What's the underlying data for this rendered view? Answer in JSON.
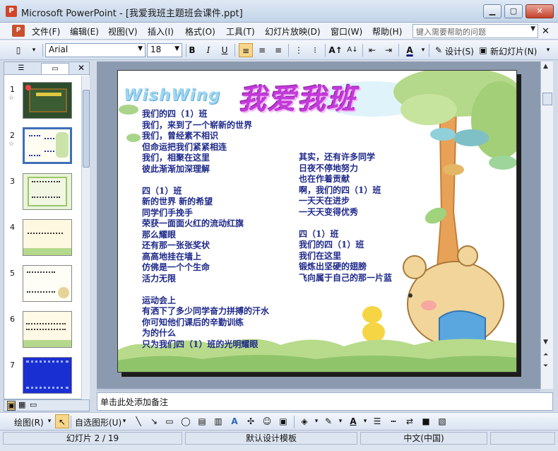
{
  "window": {
    "app_title": "Microsoft PowerPoint - [我爱我班主题班会课件.ppt]",
    "app_icon": "P"
  },
  "menu": {
    "items": [
      "文件(F)",
      "编辑(E)",
      "视图(V)",
      "插入(I)",
      "格式(O)",
      "工具(T)",
      "幻灯片放映(D)",
      "窗口(W)",
      "帮助(H)"
    ],
    "help_placeholder": "键入需要帮助的问题"
  },
  "toolbar": {
    "font": "Arial",
    "size": "18",
    "bold": "B",
    "italic": "I",
    "underline": "U",
    "design_label": "设计(S)",
    "new_slide_label": "新幻灯片(N)"
  },
  "slide_pane": {
    "thumbs": [
      {
        "num": "1"
      },
      {
        "num": "2"
      },
      {
        "num": "3"
      },
      {
        "num": "4"
      },
      {
        "num": "5"
      },
      {
        "num": "6"
      },
      {
        "num": "7"
      }
    ]
  },
  "slide": {
    "title": "我爱我班",
    "logo": "WishWing",
    "col1": [
      "我们的四（1）班",
      "我们，来到了一个崭新的世界",
      "我们，曾经素不相识",
      "但命运把我们紧紧相连",
      "我们，相聚在这里",
      "彼此渐渐加深理解",
      "",
      "四（1）班",
      "新的世界 新的希望",
      "同学们手挽手",
      "荣获一面面火红的流动红旗",
      "那么耀眼",
      "还有那一张张奖状",
      "高高地挂在墙上",
      "仿佛是一个个生命",
      "活力无限",
      "",
      "运动会上",
      "有洒下了多少同学奋力拼搏的汗水",
      "你可知他们课后的辛勤训练",
      "为的什么",
      "只为我们四（1）班的光明耀眼"
    ],
    "col2": [
      "其实，还有许多同学",
      "日夜不停地努力",
      "也在作着贡献",
      "啊，我们的四（1）班",
      "一天天在进步",
      "一天天变得优秀",
      "",
      "四（1）班",
      "我们的四（1）班",
      "我们在这里",
      "锻炼出坚硬的翅膀",
      "飞向属于自己的那一片蓝"
    ]
  },
  "notes": {
    "placeholder": "单击此处添加备注"
  },
  "drawbar": {
    "draw_label": "绘图(R)",
    "autoshape_label": "自选图形(U)"
  },
  "status": {
    "slide_pos": "幻灯片 2 / 19",
    "template": "默认设计模板",
    "language": "中文(中国)"
  },
  "colors": {
    "accent": "#3f6fba",
    "slide_text": "#1f2a8a",
    "title": "#c23ad8"
  }
}
